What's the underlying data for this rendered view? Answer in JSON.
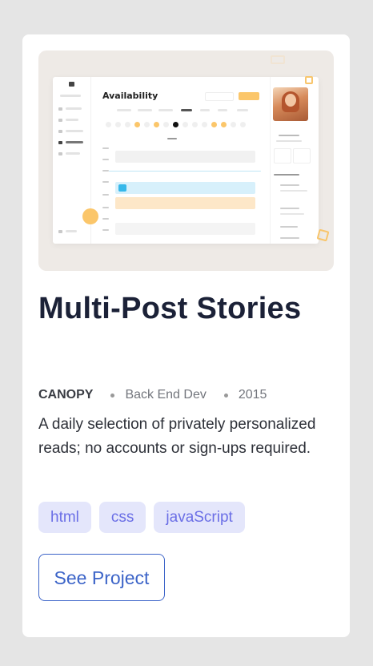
{
  "card": {
    "title": "Multi-Post Stories",
    "company": "CANOPY",
    "role": "Back End Dev",
    "year": "2015",
    "description": "A daily selection of privately personalized reads; no accounts or sign-ups required.",
    "tags": [
      "html",
      "css",
      "javaScript"
    ],
    "cta_label": "See Project"
  },
  "preview": {
    "heading": "Availability",
    "accent_color": "#fbc66a",
    "icon": "screenshot-preview"
  },
  "colors": {
    "title": "#1b2137",
    "tag_bg": "#e4e6fb",
    "tag_text": "#6b6fe6",
    "button": "#3c64c8"
  }
}
